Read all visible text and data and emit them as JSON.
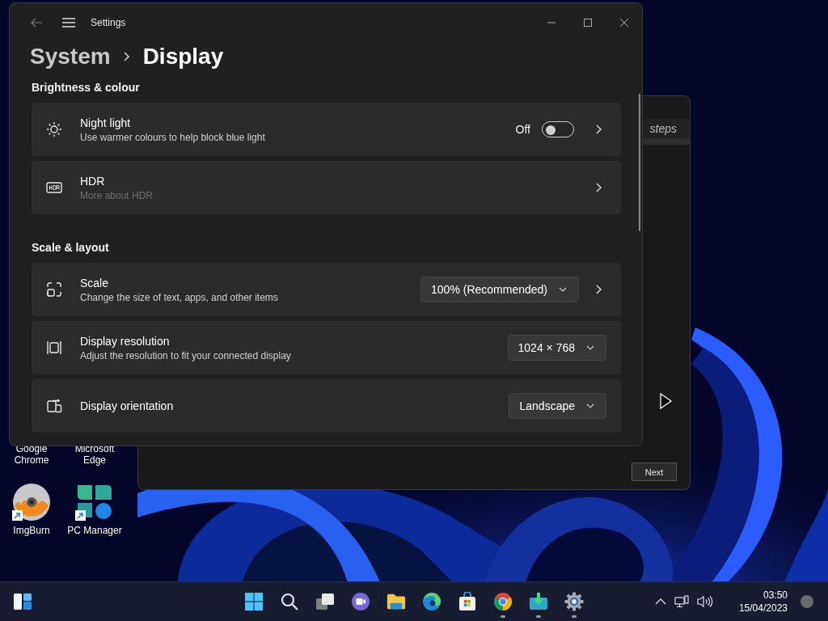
{
  "settings_window": {
    "title": "Settings",
    "breadcrumb": [
      {
        "label": "System",
        "current": false
      },
      {
        "label": "Display",
        "current": true
      }
    ],
    "sections": [
      {
        "title": "Brightness & colour",
        "rows": [
          {
            "kind": "toggle",
            "title": "Night light",
            "subtitle": "Use warmer colours to help block blue light",
            "muted": false,
            "value": "Off",
            "on": false,
            "chevron": true
          },
          {
            "kind": "link",
            "title": "HDR",
            "subtitle": "More about HDR",
            "muted": true,
            "chevron": true
          }
        ]
      },
      {
        "title": "Scale & layout",
        "rows": [
          {
            "kind": "dropdown",
            "title": "Scale",
            "subtitle": "Change the size of text, apps, and other items",
            "muted": false,
            "value": "100% (Recommended)",
            "chevron": true
          },
          {
            "kind": "dropdown",
            "title": "Display resolution",
            "subtitle": "Adjust the resolution to fit your connected display",
            "muted": false,
            "value": "1024 × 768",
            "chevron": false
          },
          {
            "kind": "dropdown",
            "title": "Display orientation",
            "value": "Landscape",
            "chevron": false
          }
        ]
      }
    ]
  },
  "background_window": {
    "heading": "steps",
    "button": "Next"
  },
  "desktop_icons": [
    {
      "kind": "label",
      "label": "Google Chrome"
    },
    {
      "kind": "label",
      "label": "Microsoft Edge"
    },
    {
      "kind": "disc",
      "label": "ImgBurn"
    },
    {
      "kind": "petals",
      "label": "PC Manager"
    }
  ],
  "taskbar": {
    "apps": [
      {
        "kind": "start",
        "running": false
      },
      {
        "kind": "search",
        "running": false
      },
      {
        "kind": "taskview",
        "running": false
      },
      {
        "kind": "chat",
        "running": false
      },
      {
        "kind": "folder",
        "running": false
      },
      {
        "kind": "edge",
        "running": false
      },
      {
        "kind": "store",
        "running": false
      },
      {
        "kind": "chrome",
        "running": true
      },
      {
        "kind": "download",
        "running": true
      },
      {
        "kind": "gear",
        "running": true
      }
    ],
    "time": "03:50",
    "date": "15/04/2023"
  }
}
